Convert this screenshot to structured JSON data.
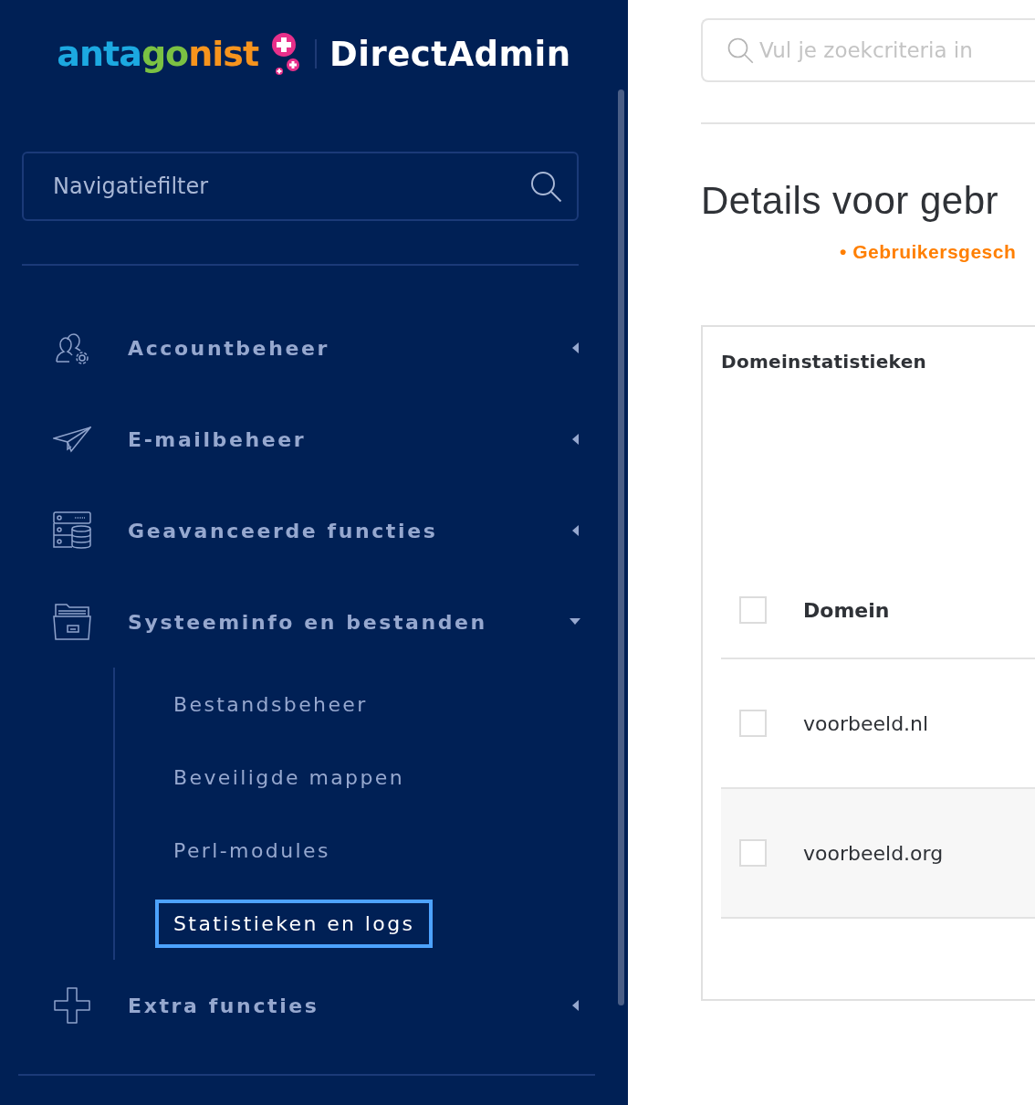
{
  "logo": {
    "brand": "antagonist",
    "product": "DirectAdmin"
  },
  "sidebar": {
    "filter": {
      "placeholder": "Navigatiefilter"
    },
    "items": [
      {
        "label": "Accountbeheer",
        "kind": "users",
        "expanded": false
      },
      {
        "label": "E-mailbeheer",
        "kind": "mail",
        "expanded": false
      },
      {
        "label": "Geavanceerde functies",
        "kind": "server",
        "expanded": false
      },
      {
        "label": "Systeeminfo en bestanden",
        "kind": "folder",
        "expanded": true,
        "children": [
          {
            "label": "Bestandsbeheer",
            "selected": false
          },
          {
            "label": "Beveiligde mappen",
            "selected": false
          },
          {
            "label": "Perl-modules",
            "selected": false
          },
          {
            "label": "Statistieken en logs",
            "selected": true
          }
        ]
      },
      {
        "label": "Extra functies",
        "kind": "plus",
        "expanded": false
      }
    ]
  },
  "search": {
    "placeholder": "Vul je zoekcriteria in"
  },
  "page_title": "Details voor gebr",
  "breadcrumb": "• Gebruikersgesch",
  "card": {
    "title": "Domeinstatistieken",
    "table": {
      "columns": [
        "Domein"
      ],
      "header_checkbox": {
        "checked": false
      },
      "rows": [
        {
          "domain": "voorbeeld.nl",
          "checked": false
        },
        {
          "domain": "voorbeeld.org",
          "checked": false
        }
      ]
    }
  }
}
